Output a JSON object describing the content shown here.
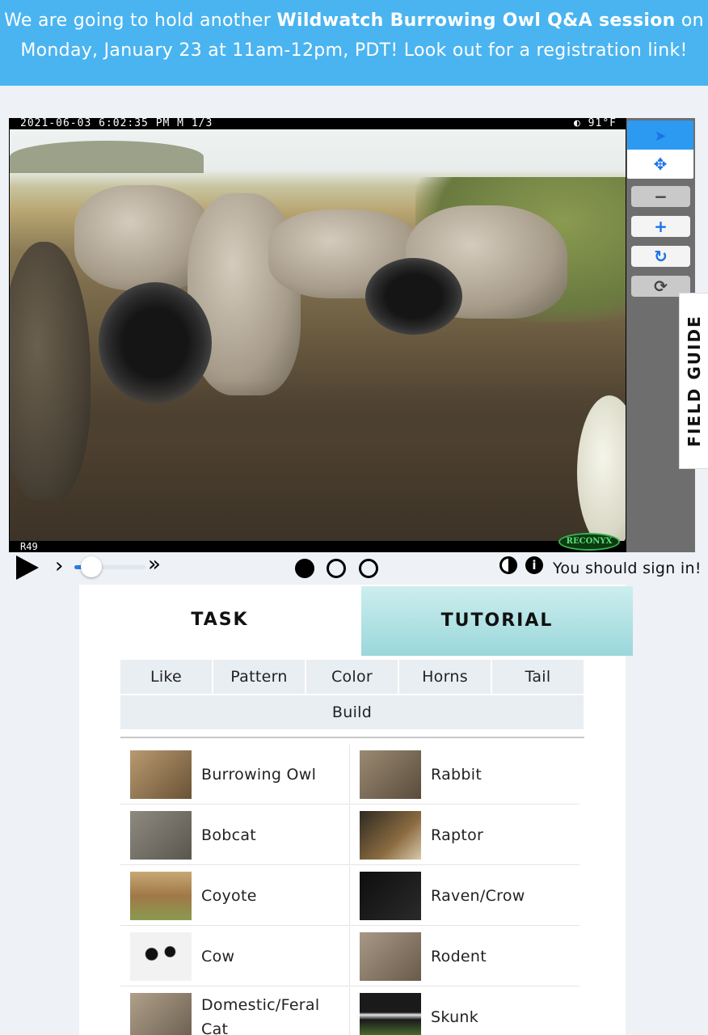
{
  "banner": {
    "pre": "We are going to hold another ",
    "bold": "Wildwatch Burrowing Owl Q&A session",
    "post": " on Monday, January 23 at 11am-12pm, PDT! Look out for a registration link!"
  },
  "camera": {
    "timestamp": "2021-06-03   6:02:35 PM   M 1/3",
    "temperature": "◐   91°F",
    "camera_id": "R49",
    "brand": "RECONYX"
  },
  "toolbar": {
    "pointer_icon": "➤",
    "move_icon": "✥",
    "zoom_out_icon": "−",
    "zoom_in_icon": "+",
    "rotate_icon": "↻",
    "reset_icon": "⟳"
  },
  "field_guide_label": "FIELD GUIDE",
  "controls": {
    "step_forward": "›",
    "fast_forward": "»",
    "frame_count": 3,
    "current_frame": 1,
    "invert_icon": "◐",
    "info_icon": "i",
    "signin_text": "You should sign in!"
  },
  "tabs": {
    "task": "TASK",
    "tutorial": "TUTORIAL"
  },
  "filters": {
    "row1": [
      "Like",
      "Pattern",
      "Color",
      "Horns",
      "Tail"
    ],
    "row2": [
      "Build"
    ]
  },
  "choices": [
    {
      "label": "Burrowing Owl",
      "thumb": "#8a6f4a"
    },
    {
      "label": "Rabbit",
      "thumb": "#7a6a55"
    },
    {
      "label": "Bobcat",
      "thumb": "#7a756a"
    },
    {
      "label": "Raptor",
      "thumb": "#5a4a38"
    },
    {
      "label": "Coyote",
      "thumb": "#a88a5a"
    },
    {
      "label": "Raven/Crow",
      "thumb": "#1e1e1e"
    },
    {
      "label": "Cow",
      "thumb": "#e8e8e8"
    },
    {
      "label": "Rodent",
      "thumb": "#8a7a6a"
    },
    {
      "label": "Domestic/Feral Cat",
      "thumb": "#7a6e60"
    },
    {
      "label": "Skunk",
      "thumb": "#3a3a3a"
    }
  ]
}
